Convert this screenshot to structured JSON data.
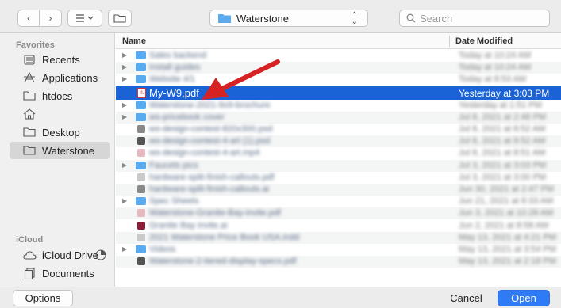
{
  "toolbar": {
    "back_glyph": "‹",
    "forward_glyph": "›",
    "location": "Waterstone",
    "search_placeholder": "Search"
  },
  "sidebar": {
    "favorites_label": "Favorites",
    "favorites": [
      {
        "label": "Recents",
        "icon": "recents-icon"
      },
      {
        "label": "Applications",
        "icon": "applications-icon"
      },
      {
        "label": "htdocs",
        "icon": "folder-icon"
      },
      {
        "label": "",
        "icon": "home-icon"
      },
      {
        "label": "Desktop",
        "icon": "folder-icon"
      },
      {
        "label": "Waterstone",
        "icon": "folder-icon",
        "selected": true
      }
    ],
    "icloud_label": "iCloud",
    "icloud": [
      {
        "label": "iCloud Drive",
        "icon": "cloud-icon"
      },
      {
        "label": "Documents",
        "icon": "documents-icon"
      }
    ]
  },
  "list": {
    "col_name": "Name",
    "col_date": "Date Modified",
    "rows": [
      {
        "name": "Sales backend",
        "date": "Today at 10:24 AM",
        "kind": "folder",
        "blurred": true
      },
      {
        "name": "Install guides",
        "date": "Today at 10:24 AM",
        "kind": "folder",
        "blurred": true
      },
      {
        "name": "Website 4/1",
        "date": "Today at 8:53 AM",
        "kind": "folder",
        "blurred": true
      },
      {
        "name": "My-W9.pdf",
        "date": "Yesterday at 3:03 PM",
        "kind": "pdf",
        "selected": true
      },
      {
        "name": "Waterstone-2021-9x9-brochure",
        "date": "Yesterday at 1:51 PM",
        "kind": "folder",
        "blurred": true
      },
      {
        "name": "ws-pricebook cover",
        "date": "Jul 8, 2021 at 2:48 PM",
        "kind": "folder",
        "blurred": true
      },
      {
        "name": "ws-design-contest-820x300.psd",
        "date": "Jul 8, 2021 at 8:52 AM",
        "kind": "file",
        "blurred": true
      },
      {
        "name": "ws-design-contest-4-art (1).psd",
        "date": "Jul 8, 2021 at 8:52 AM",
        "kind": "file",
        "blurred": true
      },
      {
        "name": "ws-design-contest-4-art.mp4",
        "date": "Jul 8, 2021 at 8:51 AM",
        "kind": "file",
        "blurred": true
      },
      {
        "name": "Faucets pics",
        "date": "Jul 3, 2021 at 3:03 PM",
        "kind": "folder",
        "blurred": true
      },
      {
        "name": "hardware-split-finish-callouts.pdf",
        "date": "Jul 3, 2021 at 3:00 PM",
        "kind": "file",
        "blurred": true
      },
      {
        "name": "hardware-split-finish-callouts.ai",
        "date": "Jun 30, 2021 at 2:47 PM",
        "kind": "file",
        "blurred": true
      },
      {
        "name": "Spec Sheets",
        "date": "Jun 21, 2021 at 8:33 AM",
        "kind": "folder",
        "blurred": true
      },
      {
        "name": "Waterstone-Granite-Bay-invite.pdf",
        "date": "Jun 3, 2021 at 10:28 AM",
        "kind": "file",
        "blurred": true
      },
      {
        "name": "Granite Bay invite.ai",
        "date": "Jun 2, 2021 at 8:58 AM",
        "kind": "file",
        "blurred": true
      },
      {
        "name": "2021 Waterstone Price Book USA.indd",
        "date": "May 13, 2021 at 4:21 PM",
        "kind": "file",
        "blurred": true
      },
      {
        "name": "Videos",
        "date": "May 13, 2021 at 3:54 PM",
        "kind": "folder",
        "blurred": true
      },
      {
        "name": "Waterstone-2-tiered-display-specs.pdf",
        "date": "May 13, 2021 at 2:18 PM",
        "kind": "file",
        "blurred": true
      }
    ]
  },
  "footer": {
    "options_label": "Options",
    "cancel_label": "Cancel",
    "open_label": "Open"
  },
  "colors": {
    "accent": "#1a63d6",
    "open_button": "#2f7bf5",
    "annotation_arrow": "#d62222",
    "folder": "#5aaaf0"
  }
}
